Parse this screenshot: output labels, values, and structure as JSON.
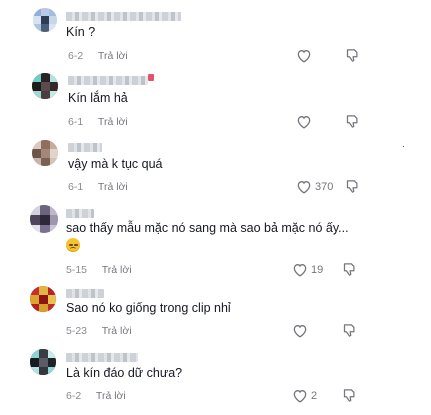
{
  "comments": [
    {
      "text": "Kín ?",
      "date": "6-2",
      "reply": "Trả lời",
      "likes": ""
    },
    {
      "text": "Kín lắm hả",
      "date": "6-1",
      "reply": "Trả lời",
      "likes": ""
    },
    {
      "text": "vậy mà k tục quá",
      "date": "6-1",
      "reply": "Trả lời",
      "likes": "370"
    },
    {
      "text": "sao thấy mẫu mặc nó sang mà sao bả mặc nó ấy...",
      "date": "5-15",
      "reply": "Trả lời",
      "likes": "19",
      "emoji": "sad-face-emoji"
    },
    {
      "text": "Sao nó ko giống trong clip nhỉ",
      "date": "5-23",
      "reply": "Trả lời",
      "likes": ""
    },
    {
      "text": "Là kín đáo dữ chưa?",
      "date": "6-2",
      "reply": "Trả lời",
      "likes": "2"
    }
  ],
  "icons": {
    "like": "heart-outline-icon",
    "dislike": "thumbs-down-outline-icon"
  },
  "colors": {
    "text": "#161823",
    "meta": "#8a8b91",
    "icon": "#75767c"
  }
}
